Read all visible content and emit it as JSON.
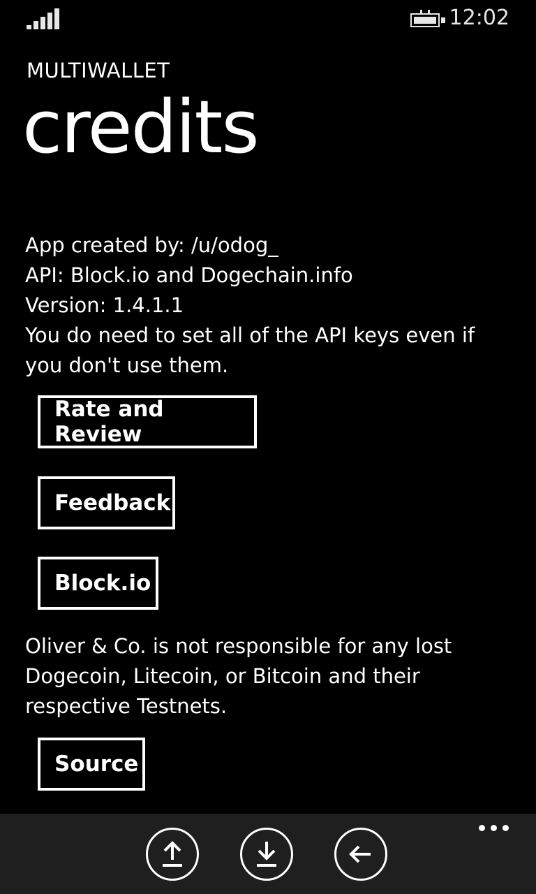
{
  "status_bar": {
    "time": "12:02",
    "signal_icon": "signal-strength-icon",
    "battery_icon": "battery-charging-icon"
  },
  "header": {
    "app_title": "MULTIWALLET",
    "page_title": "credits"
  },
  "info": {
    "lines": [
      "App created by: /u/odog_",
      "API: Block.io and Dogechain.info",
      "Version: 1.4.1.1",
      "You do need to set all of the API keys even if you don't use them."
    ]
  },
  "buttons": {
    "rate": "Rate and Review",
    "feedback": "Feedback",
    "blockio": "Block.io",
    "source": "Source"
  },
  "disclaimer": "Oliver & Co. is not responsible for any lost Dogecoin, Litecoin, or Bitcoin and their respective Testnets.",
  "app_bar": {
    "icons": [
      "upload-icon",
      "download-icon",
      "back-arrow-icon",
      "more-icon"
    ]
  }
}
